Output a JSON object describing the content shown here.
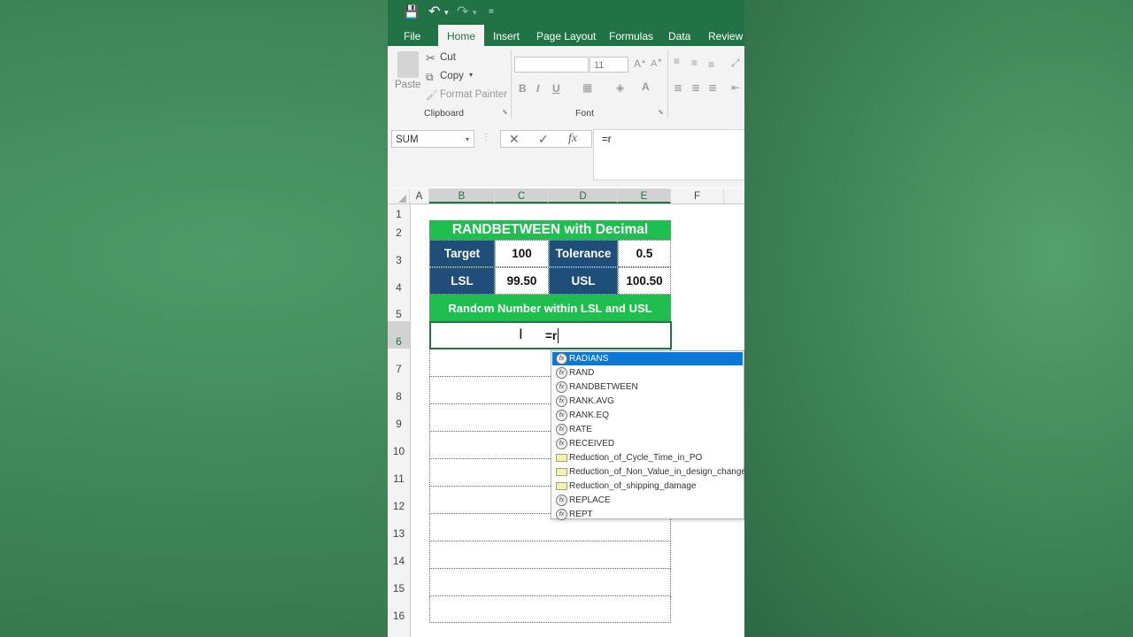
{
  "qat": {
    "save_icon": "💾",
    "undo_icon": "↶",
    "redo_icon": "↷",
    "more_icon": "="
  },
  "tabs": [
    "File",
    "Home",
    "Insert",
    "Page Layout",
    "Formulas",
    "Data",
    "Review"
  ],
  "ribbon": {
    "paste": "Paste",
    "cut": "Cut",
    "copy": "Copy",
    "format_painter": "Format Painter",
    "clipboard_group": "Clipboard",
    "font_group": "Font",
    "font_size": "11",
    "bold": "B",
    "italic": "I",
    "underline": "U"
  },
  "formula_bar": {
    "name_box": "SUM",
    "formula": "=r",
    "cancel": "✕",
    "enter": "✓",
    "fx": "fx"
  },
  "columns": [
    "A",
    "B",
    "C",
    "D",
    "E",
    "F"
  ],
  "rows": [
    "1",
    "2",
    "3",
    "4",
    "5",
    "6",
    "7",
    "8",
    "9",
    "10",
    "11",
    "12",
    "13",
    "14",
    "15",
    "16"
  ],
  "sheet": {
    "title": "RANDBETWEEN with Decimal",
    "target_label": "Target",
    "target_value": "100",
    "tolerance_label": "Tolerance",
    "tolerance_value": "0.5",
    "lsl_label": "LSL",
    "lsl_value": "99.50",
    "usl_label": "USL",
    "usl_value": "100.50",
    "subtitle": "Random Number within LSL and USL",
    "active_cell_text": "=r"
  },
  "autocomplete": [
    {
      "label": "RADIANS",
      "kind": "function",
      "selected": true
    },
    {
      "label": "RAND",
      "kind": "function"
    },
    {
      "label": "RANDBETWEEN",
      "kind": "function"
    },
    {
      "label": "RANK.AVG",
      "kind": "function"
    },
    {
      "label": "RANK.EQ",
      "kind": "function"
    },
    {
      "label": "RATE",
      "kind": "function"
    },
    {
      "label": "RECEIVED",
      "kind": "function"
    },
    {
      "label": "Reduction_of_Cycle_Time_in_PO",
      "kind": "name"
    },
    {
      "label": "Reduction_of_Non_Value_in_design_change",
      "kind": "name"
    },
    {
      "label": "Reduction_of_shipping_damage",
      "kind": "name"
    },
    {
      "label": "REPLACE",
      "kind": "function"
    },
    {
      "label": "REPT",
      "kind": "function"
    }
  ],
  "colors": {
    "excel_green": "#217346",
    "title_green": "#1fbf4f",
    "header_blue": "#1f4e79",
    "highlight": "#0b78d7"
  }
}
